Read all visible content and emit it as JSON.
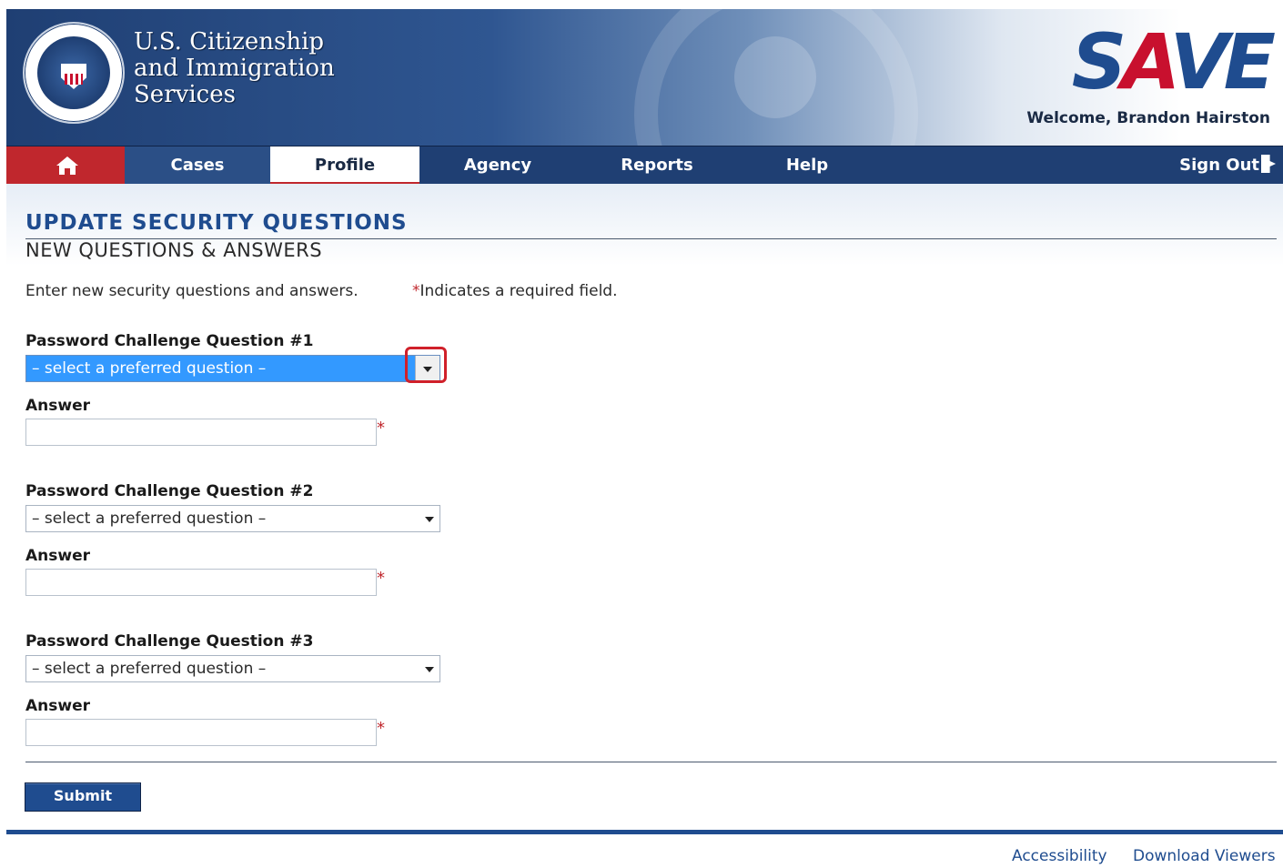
{
  "header": {
    "agency_lines": [
      "U.S. Citizenship",
      "and Immigration",
      "Services"
    ],
    "logo": {
      "pre": "S",
      "accent": "A",
      "post": "VE"
    },
    "welcome": "Welcome, Brandon Hairston"
  },
  "nav": {
    "home_icon": "home-icon",
    "items": [
      {
        "label": "Cases"
      },
      {
        "label": "Profile",
        "active": true
      },
      {
        "label": "Agency"
      },
      {
        "label": "Reports"
      },
      {
        "label": "Help"
      }
    ],
    "signout": "Sign Out",
    "signout_icon": "sign-out-icon"
  },
  "page": {
    "title": "UPDATE SECURITY QUESTIONS",
    "subtitle": "NEW QUESTIONS & ANSWERS",
    "intro": "Enter new security questions and answers.",
    "required_star": "*",
    "required_note": "Indicates a required field."
  },
  "questions": [
    {
      "label": "Password Challenge Question #1",
      "placeholder": "– select a preferred question –",
      "answer_label": "Answer",
      "answer_value": ""
    },
    {
      "label": "Password Challenge Question #2",
      "placeholder": "– select a preferred question –",
      "answer_label": "Answer",
      "answer_value": ""
    },
    {
      "label": "Password Challenge Question #3",
      "placeholder": "– select a preferred question –",
      "answer_label": "Answer",
      "answer_value": ""
    }
  ],
  "submit_label": "Submit",
  "footer": {
    "links": [
      "Accessibility",
      "Download Viewers"
    ]
  },
  "colors": {
    "brand_blue": "#1f4c8f",
    "nav_blue": "#1f3f73",
    "accent_red": "#c0272d",
    "select_highlight": "#3399ff"
  }
}
